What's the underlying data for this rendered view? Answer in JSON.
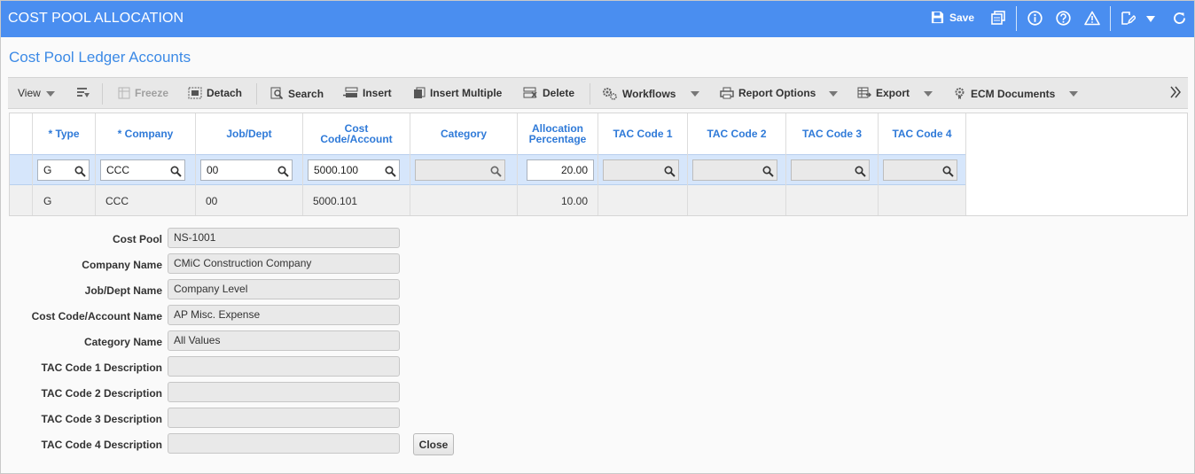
{
  "header": {
    "title": "COST POOL ALLOCATION",
    "save_label": "Save",
    "bg_color": "#4a8ef0"
  },
  "section": {
    "title": "Cost Pool Ledger Accounts"
  },
  "toolbar": {
    "view": "View",
    "freeze": "Freeze",
    "detach": "Detach",
    "search": "Search",
    "insert": "Insert",
    "insert_multiple": "Insert Multiple",
    "delete": "Delete",
    "workflows": "Workflows",
    "report_options": "Report Options",
    "export": "Export",
    "ecm_documents": "ECM Documents"
  },
  "grid": {
    "columns": {
      "type": "* Type",
      "company": "* Company",
      "job_dept": "Job/Dept",
      "cost_code_1": "Cost",
      "cost_code_2": "Code/Account",
      "category": "Category",
      "alloc_1": "Allocation",
      "alloc_2": "Percentage",
      "tac1": "TAC Code 1",
      "tac2": "TAC Code 2",
      "tac3": "TAC Code 3",
      "tac4": "TAC Code 4"
    },
    "edit_row": {
      "type": "G",
      "company": "CCC",
      "job_dept": "00",
      "cost_code": "5000.100",
      "category": "",
      "allocation": "20.00",
      "tac1": "",
      "tac2": "",
      "tac3": "",
      "tac4": ""
    },
    "rows": [
      {
        "type": "G",
        "company": "CCC",
        "job_dept": "00",
        "cost_code": "5000.101",
        "category": "",
        "allocation": "10.00"
      }
    ]
  },
  "details": {
    "cost_pool_label": "Cost Pool",
    "cost_pool": "NS-1001",
    "company_name_label": "Company Name",
    "company_name": "CMiC Construction Company",
    "job_dept_name_label": "Job/Dept Name",
    "job_dept_name": "Company Level",
    "cost_code_name_label": "Cost Code/Account Name",
    "cost_code_name": "AP Misc. Expense",
    "category_name_label": "Category Name",
    "category_name": "All Values",
    "tac1_desc_label": "TAC Code 1 Description",
    "tac1_desc": "",
    "tac2_desc_label": "TAC Code 2 Description",
    "tac2_desc": "",
    "tac3_desc_label": "TAC Code 3 Description",
    "tac3_desc": "",
    "tac4_desc_label": "TAC Code 4 Description",
    "tac4_desc": "",
    "close_label": "Close"
  }
}
